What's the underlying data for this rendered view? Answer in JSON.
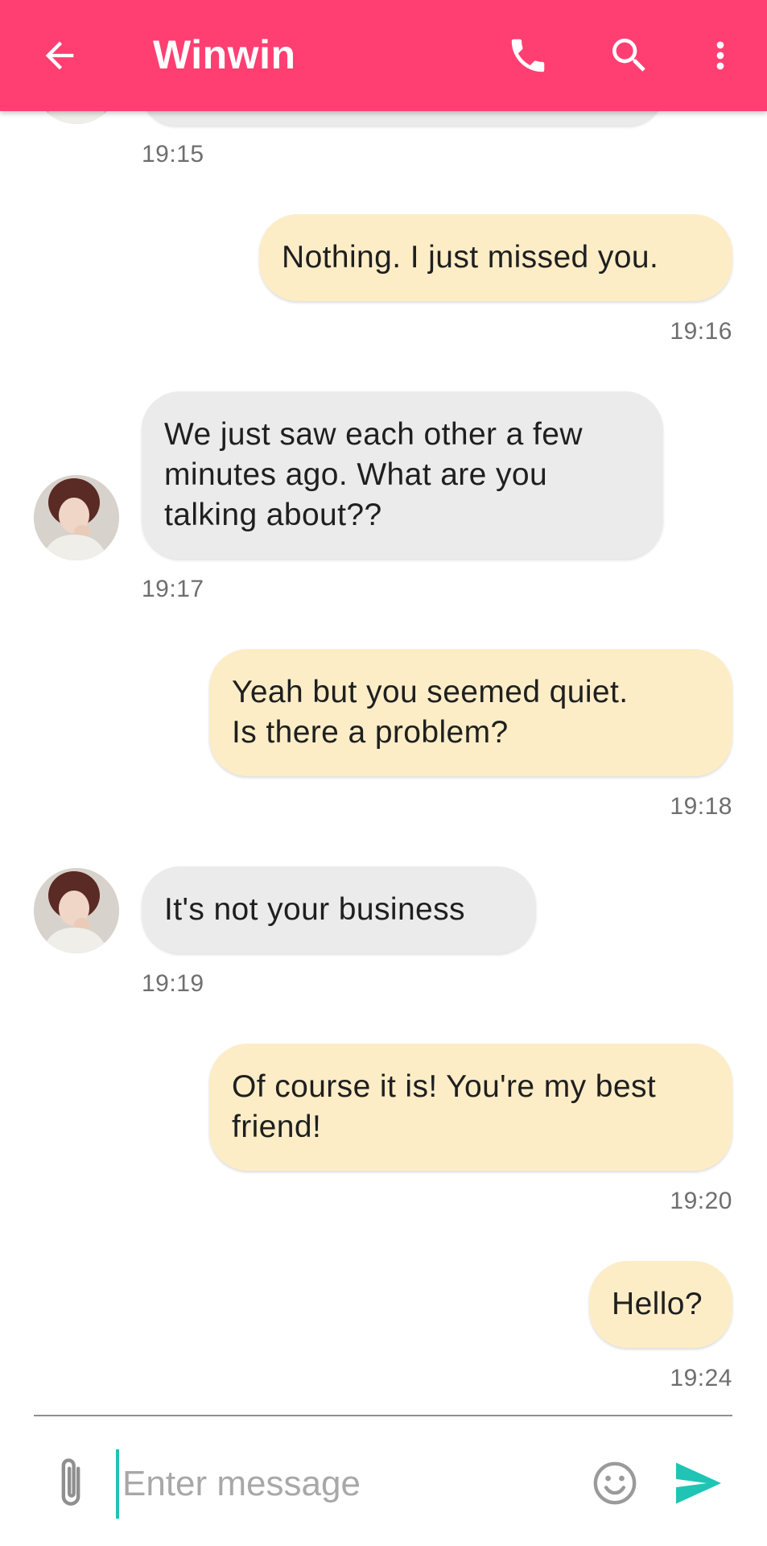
{
  "header": {
    "title": "Winwin",
    "back_icon": "arrow-back-icon",
    "call_icon": "phone-icon",
    "search_icon": "search-icon",
    "more_icon": "more-vert-icon"
  },
  "messages": [
    {
      "direction": "incoming",
      "lines": [],
      "time": "19:15"
    },
    {
      "direction": "outgoing",
      "lines": [
        "Nothing. I just missed you."
      ],
      "time": "19:16"
    },
    {
      "direction": "incoming",
      "lines": [
        "We just saw each other a few",
        "minutes ago. What are you",
        "talking about??"
      ],
      "time": "19:17"
    },
    {
      "direction": "outgoing",
      "lines": [
        "Yeah but you seemed quiet.",
        "Is there a problem?"
      ],
      "time": "19:18"
    },
    {
      "direction": "incoming",
      "lines": [
        "It's not your business"
      ],
      "time": "19:19"
    },
    {
      "direction": "outgoing",
      "lines": [
        "Of course it is! You're my best",
        "friend!"
      ],
      "time": "19:20"
    },
    {
      "direction": "outgoing",
      "lines": [
        "Hello?"
      ],
      "time": "19:24"
    }
  ],
  "composer": {
    "placeholder": "Enter message",
    "value": "",
    "attach_icon": "paperclip-icon",
    "emoji_icon": "emoji-smile-icon",
    "send_icon": "send-icon"
  },
  "colors": {
    "appbar": "#ff3f72",
    "incoming_bubble": "#ebebeb",
    "outgoing_bubble": "#fdedc7",
    "send_accent": "#1fc4b4",
    "cursor_accent": "#1fc4b4"
  }
}
